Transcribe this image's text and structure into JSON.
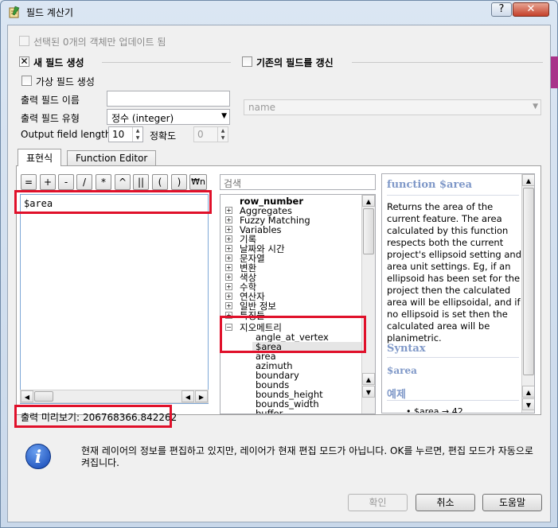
{
  "window": {
    "title": "필드 계산기",
    "help_label": "?",
    "close_label": "✕"
  },
  "options": {
    "update_selected_only": "선택된 0개의 객체만 업데이트 됨",
    "create_new_field": "새 필드 생성",
    "update_existing_field": "기존의 필드를 갱신",
    "virtual_field": "가상 필드 생성",
    "output_field_name_label": "출력 필드 이름",
    "output_field_name_value": "",
    "output_field_type_label": "출력 필드 유형",
    "output_field_type_value": "정수 (integer)",
    "output_field_length_label": "Output field length",
    "output_field_length_value": "10",
    "precision_label": "정확도",
    "precision_value": "0",
    "existing_field_value": "name"
  },
  "tabs": [
    {
      "label": "표현식",
      "active": true
    },
    {
      "label": "Function Editor",
      "active": false
    }
  ],
  "operators": [
    "=",
    "+",
    "-",
    "/",
    "*",
    "^",
    "||",
    "(",
    ")",
    "₩n"
  ],
  "expression": "$area",
  "search_placeholder": "검색",
  "function_tree": {
    "top_items": [
      {
        "label": "row_number",
        "bold": true,
        "expandable": false
      },
      {
        "label": "Aggregates",
        "expandable": true
      },
      {
        "label": "Fuzzy Matching",
        "expandable": true
      },
      {
        "label": "Variables",
        "expandable": true
      },
      {
        "label": "기록",
        "expandable": true
      },
      {
        "label": "날짜와 시간",
        "expandable": true
      },
      {
        "label": "문자열",
        "expandable": true
      },
      {
        "label": "변환",
        "expandable": true
      },
      {
        "label": "색상",
        "expandable": true
      },
      {
        "label": "수학",
        "expandable": true
      },
      {
        "label": "연산자",
        "expandable": true
      },
      {
        "label": "일반 정보",
        "expandable": true
      },
      {
        "label": "특징들",
        "expandable": true
      }
    ],
    "geometry_group": "지오메트리",
    "geometry_children": [
      "angle_at_vertex",
      "$area",
      "area",
      "azimuth",
      "boundary",
      "bounds",
      "bounds_height",
      "bounds_width",
      "buffer"
    ]
  },
  "help": {
    "title": "function $area",
    "body": "Returns the area of the current feature. The area calculated by this function respects both the current project's ellipsoid setting and area unit settings. Eg, if an ellipsoid has been set for the project then the calculated area will be ellipsoidal, and if no ellipsoid is set then the calculated area will be planimetric.",
    "syntax_heading": "Syntax",
    "syntax": "$area",
    "examples_heading": "예제",
    "example_partial": "• $area → 42"
  },
  "preview": {
    "label": "출력 미리보기:",
    "value": "206768366.842262"
  },
  "info_message": "현재 레이어의 정보를 편집하고 있지만, 레이어가 현재 편집 모드가 아닙니다. OK를 누르면, 편집 모드가 자동으로 켜집니다.",
  "buttons": {
    "ok": "확인",
    "cancel": "취소",
    "help": "도움말"
  }
}
